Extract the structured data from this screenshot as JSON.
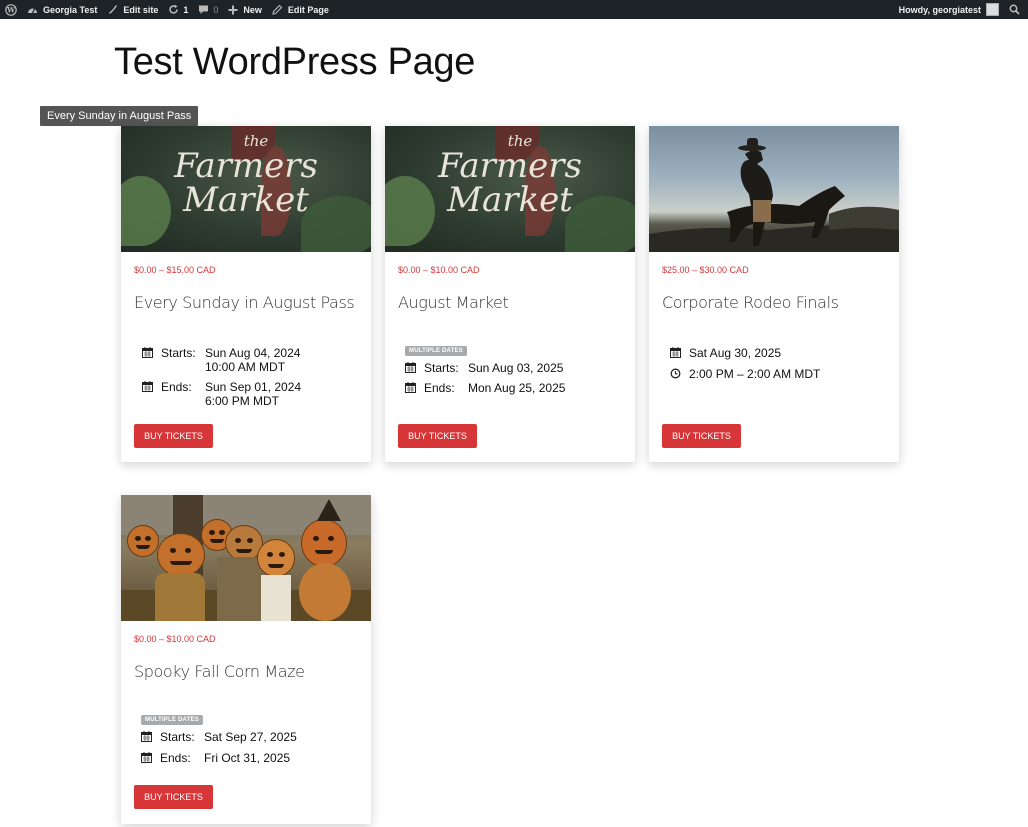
{
  "adminbar": {
    "site_name": "Georgia Test",
    "edit_site": "Edit site",
    "updates_count": "1",
    "comments_count": "0",
    "new_label": "New",
    "edit_page": "Edit Page",
    "howdy": "Howdy, georgiatest"
  },
  "page": {
    "title": "Test WordPress Page",
    "tooltip": "Every Sunday in August Pass"
  },
  "colors": {
    "accent": "#d63638",
    "adminbar": "#1d2327",
    "badge": "#a7aaad"
  },
  "cards": [
    {
      "image": "farmers-market-image",
      "image_text_small": "the",
      "image_text_large": "Farmers Market",
      "price": "$0.00 – $15.00 CAD",
      "title": "Every Sunday in August Pass",
      "starts_label": "Starts:",
      "starts_date": "Sun Aug 04, 2024",
      "starts_time": "10:00 AM MDT",
      "ends_label": "Ends:",
      "ends_date": "Sun Sep 01, 2024",
      "ends_time": "6:00 PM MDT",
      "button": "BUY TICKETS"
    },
    {
      "image": "farmers-market-image",
      "image_text_small": "the",
      "image_text_large": "Farmers Market",
      "price": "$0.00 – $10.00 CAD",
      "title": "August Market",
      "badge": "MULTIPLE DATES",
      "starts_label": "Starts:",
      "starts_date": "Sun Aug 03, 2025",
      "ends_label": "Ends:",
      "ends_date": "Mon Aug 25, 2025",
      "button": "BUY TICKETS"
    },
    {
      "image": "rodeo-rider-image",
      "price": "$25.00 – $30.00 CAD",
      "title": "Corporate Rodeo Finals",
      "date": "Sat Aug 30, 2025",
      "time": "2:00 PM – 2:00 AM MDT",
      "button": "BUY TICKETS"
    },
    {
      "image": "pumpkin-scarecrows-image",
      "price": "$0.00 – $10.00 CAD",
      "title": "Spooky Fall Corn Maze",
      "badge": "MULTIPLE DATES",
      "starts_label": "Starts:",
      "starts_date": "Sat Sep 27, 2025",
      "ends_label": "Ends:",
      "ends_date": "Fri Oct 31, 2025",
      "button": "BUY TICKETS"
    }
  ]
}
